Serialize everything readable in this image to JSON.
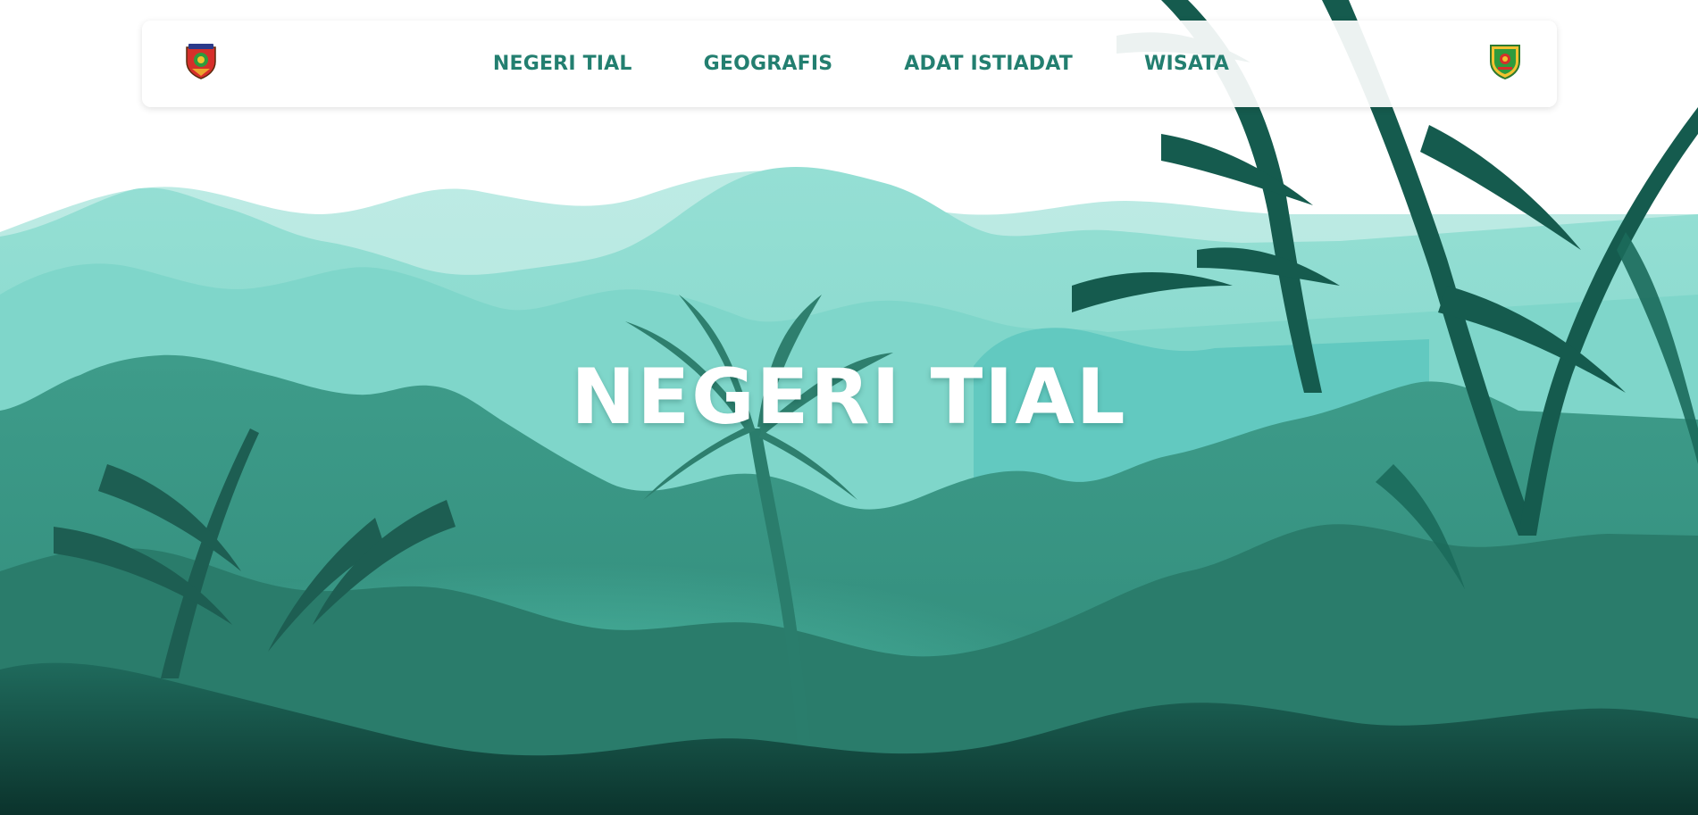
{
  "nav": {
    "links": [
      {
        "label": "NEGERI TIAL"
      },
      {
        "label": "GEOGRAFIS"
      },
      {
        "label": "ADAT ISTIADAT"
      },
      {
        "label": "WISATA"
      }
    ],
    "logo_left_icon": "regency-crest-icon",
    "logo_right_icon": "province-crest-icon"
  },
  "hero": {
    "title": "NEGERI TIAL"
  },
  "colors": {
    "nav_text": "#237f70",
    "sky": "#ffffff",
    "far_hills": "#b5e8e1",
    "mid_hills": "#8fdcd1",
    "forest": "#3f9f8d",
    "foreground": "#0f3f37",
    "title": "#ffffff"
  }
}
